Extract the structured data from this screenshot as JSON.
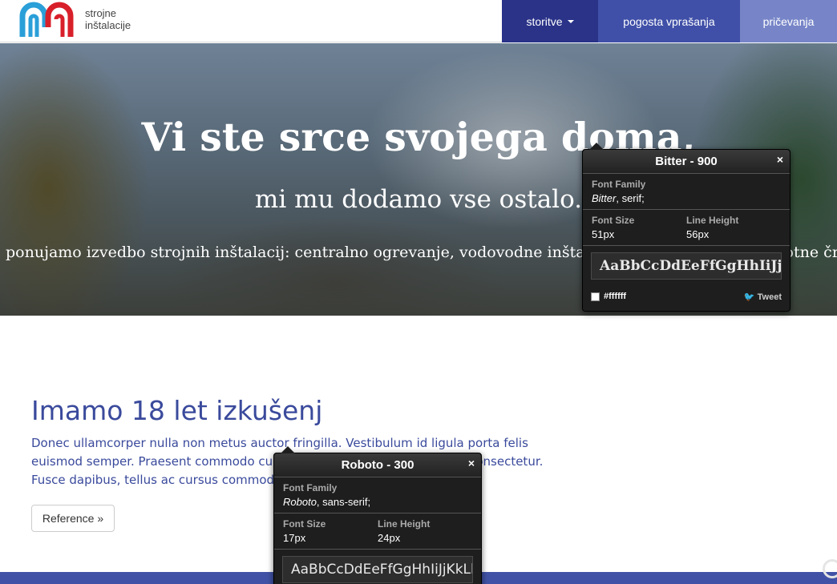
{
  "header": {
    "logo_line1": "strojne",
    "logo_line2": "inštalacije",
    "nav": [
      {
        "label": "storitve"
      },
      {
        "label": "pogosta vprašanja"
      },
      {
        "label": "pričevanja"
      }
    ],
    "colors": {
      "nav_services": "#2a3388",
      "nav_faq": "#4050a8",
      "nav_testimonials": "#7785c8",
      "logo_blue": "#2a9fd8",
      "logo_red": "#d8202a"
    }
  },
  "hero": {
    "title": "Vi ste srce svojega doma,",
    "subtitle": "mi mu dodamo vse ostalo.",
    "line": "ponujamo izvedbo strojnih inštalacij: centralno ogrevanje, vodovodne inštalacije, prezračevanje, toplotne črpalke"
  },
  "content": {
    "title": "Imamo 18 let izkušenj",
    "text": "Donec ullamcorper nulla non metus auctor fringilla. Vestibulum id ligula porta felis euismod semper. Praesent commodo cursus magna, vel scelerisque nisl consectetur. Fusce dapibus, tellus ac cursus commodo",
    "button": "Reference »"
  },
  "popups": {
    "bitter": {
      "title": "Bitter - 900",
      "close": "×",
      "family_label": "Font Family",
      "family_name": "Bitter",
      "family_rest": ", serif;",
      "size_label": "Font Size",
      "size_value": "51px",
      "lh_label": "Line Height",
      "lh_value": "56px",
      "sample": "AaBbCcDdEeFfGgHhIiJjKk",
      "color": "#ffffff",
      "tweet": "Tweet"
    },
    "roboto": {
      "title": "Roboto - 300",
      "close": "×",
      "family_label": "Font Family",
      "family_name": "Roboto",
      "family_rest": ", sans-serif;",
      "size_label": "Font Size",
      "size_value": "17px",
      "lh_label": "Line Height",
      "lh_value": "24px",
      "sample": "AaBbCcDdEeFfGgHhIiJjKkLlM"
    }
  }
}
